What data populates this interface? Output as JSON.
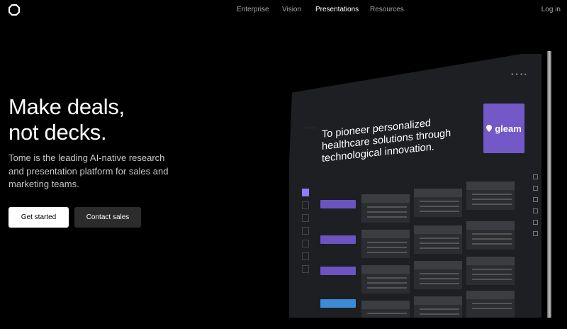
{
  "nav": {
    "links": [
      {
        "label": "Enterprise",
        "active": false
      },
      {
        "label": "Vision",
        "active": false
      },
      {
        "label": "Presentations",
        "active": true
      },
      {
        "label": "Resources",
        "active": false
      }
    ],
    "login": "Log in"
  },
  "hero": {
    "headline_line1": "Make deals,",
    "headline_line2": "not decks.",
    "subtext": "Tome is the leading AI-native research and presentation platform for sales and marketing teams.",
    "primary_cta": "Get started",
    "secondary_cta": "Contact sales"
  },
  "mockup": {
    "slide_title": "To pioneer personalized healthcare solutions through technological innovation.",
    "brand_name": "gleam",
    "colors": {
      "brand_card": "#7359c8",
      "chip_purple": "#6b54c0",
      "chip_blue": "#3c8bd6"
    }
  }
}
